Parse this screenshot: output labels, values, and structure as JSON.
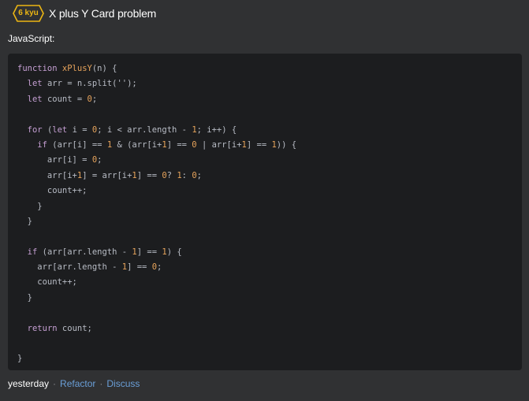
{
  "header": {
    "rank": "6 kyu",
    "title": "X plus Y Card problem"
  },
  "language": "JavaScript:",
  "code_lines": [
    [
      [
        "kw",
        "function "
      ],
      [
        "fn",
        "xPlusY"
      ],
      [
        "id",
        "(n) {"
      ]
    ],
    [
      [
        "id",
        "  "
      ],
      [
        "kw",
        "let "
      ],
      [
        "id",
        "arr = n.split('');"
      ]
    ],
    [
      [
        "id",
        "  "
      ],
      [
        "kw",
        "let "
      ],
      [
        "id",
        "count = "
      ],
      [
        "num",
        "0"
      ],
      [
        "id",
        ";"
      ]
    ],
    [],
    [
      [
        "id",
        "  "
      ],
      [
        "kw",
        "for "
      ],
      [
        "id",
        "("
      ],
      [
        "kw",
        "let "
      ],
      [
        "id",
        "i = "
      ],
      [
        "num",
        "0"
      ],
      [
        "id",
        "; i < arr.length - "
      ],
      [
        "num",
        "1"
      ],
      [
        "id",
        "; i++) {"
      ]
    ],
    [
      [
        "id",
        "    "
      ],
      [
        "kw",
        "if "
      ],
      [
        "id",
        "(arr[i] == "
      ],
      [
        "num",
        "1"
      ],
      [
        "id",
        " & (arr[i+"
      ],
      [
        "num",
        "1"
      ],
      [
        "id",
        "] == "
      ],
      [
        "num",
        "0"
      ],
      [
        "id",
        " | arr[i+"
      ],
      [
        "num",
        "1"
      ],
      [
        "id",
        "] == "
      ],
      [
        "num",
        "1"
      ],
      [
        "id",
        ")) {"
      ]
    ],
    [
      [
        "id",
        "      arr[i] = "
      ],
      [
        "num",
        "0"
      ],
      [
        "id",
        ";"
      ]
    ],
    [
      [
        "id",
        "      arr[i+"
      ],
      [
        "num",
        "1"
      ],
      [
        "id",
        "] = arr[i+"
      ],
      [
        "num",
        "1"
      ],
      [
        "id",
        "] == "
      ],
      [
        "num",
        "0"
      ],
      [
        "id",
        "? "
      ],
      [
        "num",
        "1"
      ],
      [
        "id",
        ": "
      ],
      [
        "num",
        "0"
      ],
      [
        "id",
        ";"
      ]
    ],
    [
      [
        "id",
        "      count++;"
      ]
    ],
    [
      [
        "id",
        "    }"
      ]
    ],
    [
      [
        "id",
        "  }"
      ]
    ],
    [],
    [
      [
        "id",
        "  "
      ],
      [
        "kw",
        "if "
      ],
      [
        "id",
        "(arr[arr.length - "
      ],
      [
        "num",
        "1"
      ],
      [
        "id",
        "] == "
      ],
      [
        "num",
        "1"
      ],
      [
        "id",
        ") {"
      ]
    ],
    [
      [
        "id",
        "    arr[arr.length - "
      ],
      [
        "num",
        "1"
      ],
      [
        "id",
        "] == "
      ],
      [
        "num",
        "0"
      ],
      [
        "id",
        ";"
      ]
    ],
    [
      [
        "id",
        "    count++;"
      ]
    ],
    [
      [
        "id",
        "  }"
      ]
    ],
    [],
    [
      [
        "id",
        "  "
      ],
      [
        "kw",
        "return "
      ],
      [
        "id",
        "count;"
      ]
    ],
    [],
    [
      [
        "id",
        "}"
      ]
    ]
  ],
  "footer": {
    "when": "yesterday",
    "separator": "·",
    "refactor": "Refactor",
    "discuss": "Discuss"
  }
}
